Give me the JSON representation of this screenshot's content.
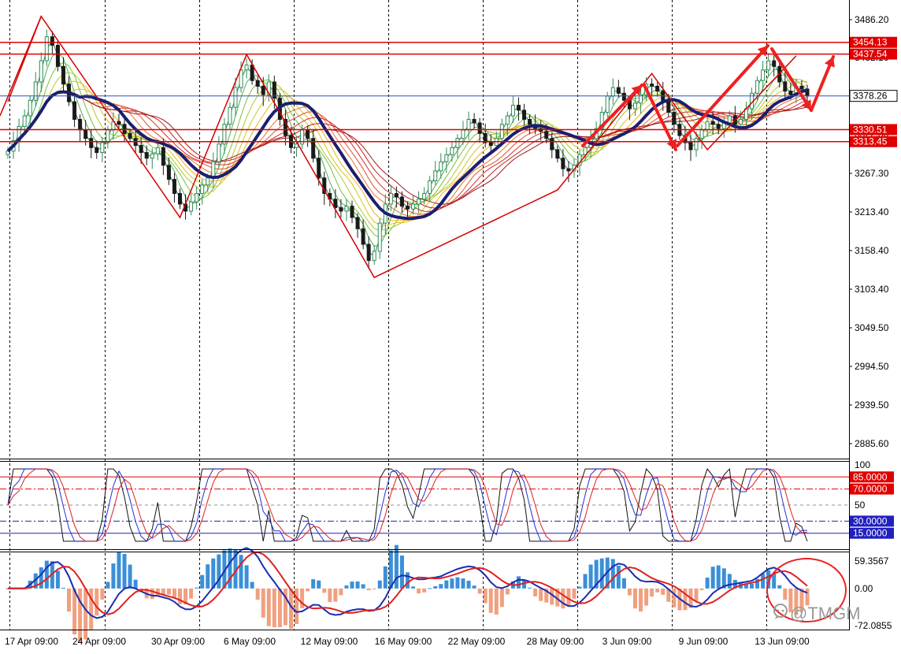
{
  "chart_data": {
    "type": "candlestick",
    "x_tick_labels": [
      "17 Apr 09:00",
      "24 Apr 09:00",
      "30 Apr 09:00",
      "6 May 09:00",
      "12 May 09:00",
      "16 May 09:00",
      "22 May 09:00",
      "28 May 09:00",
      "3 Jun 09:00",
      "9 Jun 09:00",
      "13 Jun 09:00"
    ],
    "main_panel": {
      "y_ticks": [
        "3486.20",
        "3432.10",
        "3378.26",
        "3322.30",
        "3267.30",
        "3213.40",
        "3158.40",
        "3103.40",
        "3049.50",
        "2994.50",
        "2939.50",
        "2885.60"
      ],
      "horizontal_levels": [
        {
          "label": "3454.13",
          "value": 3454.13,
          "color": "#e00000",
          "bg": "#e00000"
        },
        {
          "label": "3437.54",
          "value": 3437.54,
          "color": "#e00000",
          "bg": "#e00000"
        },
        {
          "label": "3378.26",
          "value": 3378.26,
          "color": "#3050c0",
          "bg": "#ffffff"
        },
        {
          "label": "3330.51",
          "value": 3330.51,
          "color": "#e00000",
          "bg": "#e00000"
        },
        {
          "label": "3313.45",
          "value": 3313.45,
          "color": "#e00000",
          "bg": "#e00000"
        }
      ],
      "zigzag_pivots": [
        [
          0,
          3370
        ],
        [
          6,
          3491
        ],
        [
          31,
          3206
        ],
        [
          43,
          3437
        ],
        [
          66,
          3121
        ],
        [
          99,
          3245
        ],
        [
          116,
          3410
        ],
        [
          126,
          3302
        ],
        [
          142,
          3435
        ]
      ],
      "closes": [
        3300,
        3315,
        3335,
        3350,
        3372,
        3398,
        3428,
        3462,
        3450,
        3420,
        3395,
        3370,
        3345,
        3330,
        3318,
        3305,
        3298,
        3312,
        3330,
        3342,
        3338,
        3325,
        3318,
        3308,
        3298,
        3290,
        3296,
        3305,
        3280,
        3260,
        3240,
        3225,
        3215,
        3228,
        3240,
        3252,
        3262,
        3285,
        3310,
        3338,
        3362,
        3390,
        3415,
        3422,
        3400,
        3392,
        3380,
        3398,
        3375,
        3345,
        3322,
        3305,
        3310,
        3330,
        3318,
        3290,
        3262,
        3240,
        3232,
        3220,
        3215,
        3222,
        3206,
        3190,
        3168,
        3145,
        3158,
        3198,
        3225,
        3240,
        3235,
        3222,
        3218,
        3225,
        3232,
        3240,
        3258,
        3272,
        3285,
        3295,
        3305,
        3318,
        3330,
        3345,
        3340,
        3325,
        3312,
        3308,
        3318,
        3338,
        3350,
        3365,
        3358,
        3345,
        3338,
        3332,
        3328,
        3318,
        3302,
        3290,
        3275,
        3272,
        3280,
        3295,
        3305,
        3318,
        3332,
        3355,
        3378,
        3390,
        3382,
        3372,
        3360,
        3368,
        3380,
        3395,
        3392,
        3385,
        3370,
        3355,
        3338,
        3322,
        3312,
        3302,
        3318,
        3330,
        3342,
        3338,
        3332,
        3340,
        3350,
        3338,
        3345,
        3360,
        3382,
        3400,
        3415,
        3428,
        3420,
        3398,
        3385,
        3380,
        3392,
        3388,
        3378
      ],
      "series": [
        {
          "name": "",
          "color": "#1a1f6e"
        }
      ]
    },
    "oscillator_panel": {
      "y_ticks": [
        "100",
        "85.0000",
        "70.0000",
        "50",
        "30.0000",
        "15.0000"
      ],
      "levels": [
        {
          "value": 85,
          "label": "85.0000",
          "color": "#e00000",
          "style": "solid"
        },
        {
          "value": 70,
          "label": "70.0000",
          "color": "#e00000",
          "style": "dashdot"
        },
        {
          "value": 50,
          "label": "",
          "color": "#909090",
          "style": "dash"
        },
        {
          "value": 30,
          "label": "30.0000",
          "color": "#2020c0",
          "style": "dashdot"
        },
        {
          "value": 15,
          "label": "15.0000",
          "color": "#2020c0",
          "style": "solid"
        }
      ],
      "ylim": [
        0,
        100
      ]
    },
    "macd_panel": {
      "y_ticks": [
        "59.3567",
        "0.00",
        "-72.0855"
      ],
      "ylim": [
        -72.0855,
        59.3567
      ]
    }
  },
  "watermark": "@TMGM",
  "colors": {
    "candle_up": "#2e8b57",
    "candle_down": "#1a1a1a",
    "zigzag": "#d40000",
    "ma_thick": "#1a1f6e",
    "hist_pos": "#3a8fd8",
    "hist_neg": "#f0a080"
  }
}
